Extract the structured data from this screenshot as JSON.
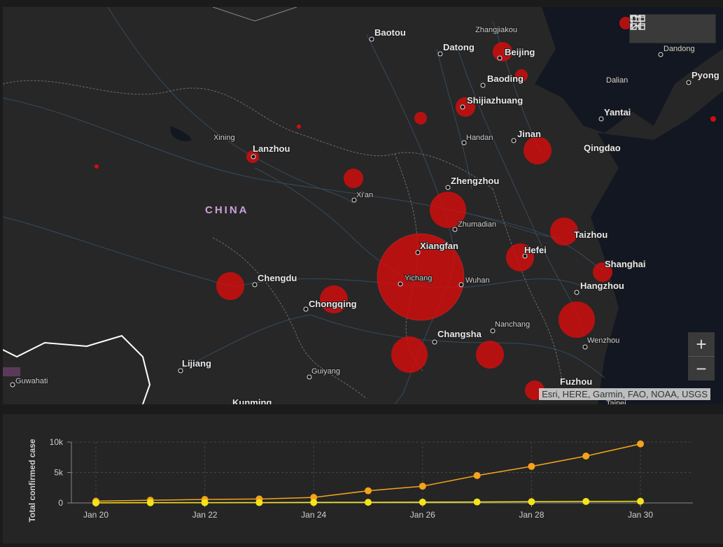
{
  "map": {
    "country_label": "CHINA",
    "attribution": "Esri, HERE, Garmin, FAO, NOAA, USGS",
    "cities": [
      {
        "name": "Baotou",
        "cls": ""
      },
      {
        "name": "Zhangjiakou",
        "cls": "small"
      },
      {
        "name": "Datong",
        "cls": ""
      },
      {
        "name": "Beijing",
        "cls": ""
      },
      {
        "name": "Dandong",
        "cls": "small"
      },
      {
        "name": "Pyong",
        "cls": ""
      },
      {
        "name": "Baoding",
        "cls": ""
      },
      {
        "name": "Dalian",
        "cls": "small"
      },
      {
        "name": "Shijiazhuang",
        "cls": ""
      },
      {
        "name": "Yantai",
        "cls": ""
      },
      {
        "name": "Handan",
        "cls": "small"
      },
      {
        "name": "Jinan",
        "cls": ""
      },
      {
        "name": "Qingdao",
        "cls": ""
      },
      {
        "name": "Xining",
        "cls": "small"
      },
      {
        "name": "Lanzhou",
        "cls": ""
      },
      {
        "name": "Xi'an",
        "cls": "small"
      },
      {
        "name": "Zhengzhou",
        "cls": ""
      },
      {
        "name": "Zhumadian",
        "cls": "small"
      },
      {
        "name": "Taizhou",
        "cls": ""
      },
      {
        "name": "Xiangfan",
        "cls": ""
      },
      {
        "name": "Hefei",
        "cls": ""
      },
      {
        "name": "Shanghai",
        "cls": ""
      },
      {
        "name": "Yichang",
        "cls": "small"
      },
      {
        "name": "Wuhan",
        "cls": "small"
      },
      {
        "name": "Hangzhou",
        "cls": ""
      },
      {
        "name": "Chengdu",
        "cls": ""
      },
      {
        "name": "Chongqing",
        "cls": ""
      },
      {
        "name": "Nanchang",
        "cls": "small"
      },
      {
        "name": "Changsha",
        "cls": ""
      },
      {
        "name": "Wenzhou",
        "cls": "small"
      },
      {
        "name": "Lijiang",
        "cls": ""
      },
      {
        "name": "Guiyang",
        "cls": "small"
      },
      {
        "name": "Guwahati",
        "cls": "small"
      },
      {
        "name": "Fuzhou",
        "cls": ""
      },
      {
        "name": "Kunming",
        "cls": ""
      },
      {
        "name": "Taipei",
        "cls": "small"
      }
    ],
    "bubble_color": "#e01010"
  },
  "tools": {
    "bookmark": "bookmark-icon",
    "legend": "legend-list-icon",
    "basemap": "basemap-gallery-icon",
    "zoom_in": "+",
    "zoom_out": "−"
  },
  "chart_data": {
    "type": "line",
    "ylabel": "Total confirmed case",
    "xlabel": "",
    "yticks": [
      "0",
      "5k",
      "10k"
    ],
    "ylim": [
      0,
      10000
    ],
    "grid": true,
    "xticks": [
      "Jan 20",
      "Jan 22",
      "Jan 24",
      "Jan 26",
      "Jan 28",
      "Jan 30"
    ],
    "x": [
      "Jan 20",
      "Jan 21",
      "Jan 22",
      "Jan 23",
      "Jan 24",
      "Jan 25",
      "Jan 26",
      "Jan 27",
      "Jan 28",
      "Jan 29",
      "Jan 30"
    ],
    "series": [
      {
        "color": "#f5a31a",
        "values": [
          290,
          440,
          570,
          640,
          900,
          2000,
          2750,
          4500,
          6000,
          7700,
          9700
        ]
      },
      {
        "color": "#f5e31a",
        "values": [
          20,
          40,
          50,
          60,
          80,
          100,
          130,
          160,
          200,
          240,
          270
        ]
      }
    ]
  }
}
